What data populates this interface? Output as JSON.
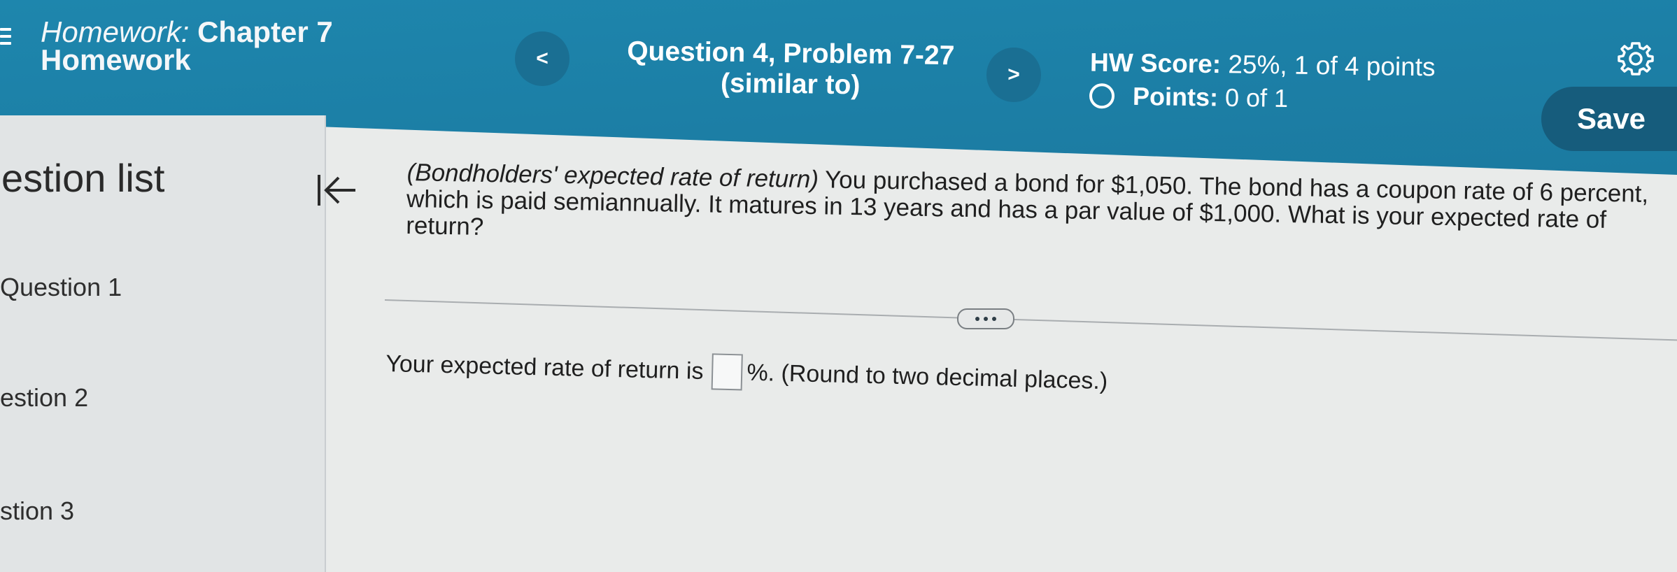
{
  "header": {
    "assignment_line1_prefix": "Homework:",
    "assignment_line1_rest": "Chapter 7",
    "assignment_line2": "Homework",
    "prev_label": "<",
    "next_label": ">",
    "question_title_line1": "Question 4, Problem 7-27",
    "question_title_line2": "(similar to)",
    "hw_score_label": "HW Score:",
    "hw_score_value": "25%, 1 of 4 points",
    "points_label": "Points:",
    "points_value": "0 of 1",
    "save_label": "Save",
    "icons": {
      "menu": "menu-icon",
      "settings": "gear-icon"
    }
  },
  "sidebar": {
    "title": "estion list",
    "collapse_icon": "collapse-left-icon",
    "items": [
      {
        "label": "Question 1"
      },
      {
        "label": "estion 2"
      },
      {
        "label": "stion 3"
      }
    ]
  },
  "problem": {
    "topic": "(Bondholders' expected rate of return)",
    "text": "You purchased a bond for $1,050. The bond has a coupon rate of 6 percent, which is paid semiannually. It matures in 13 years and has a par value of $1,000. What is your expected rate of return?"
  },
  "answer": {
    "prefix": "Your expected rate of return is",
    "value": "",
    "suffix": "%. (Round to two decimal places.)"
  },
  "colors": {
    "header_bg": "#1e86ad",
    "save_bg": "#165c7c",
    "nav_btn_bg": "#1a6f93",
    "page_bg": "#e9ebea"
  }
}
